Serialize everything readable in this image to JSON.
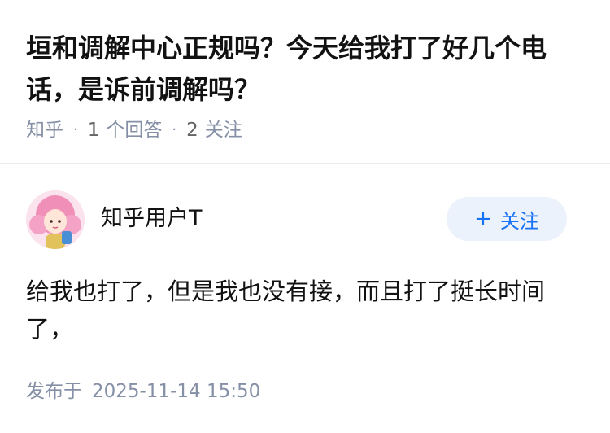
{
  "question": {
    "title": "垣和调解中心正规吗？今天给我打了好几个电话，是诉前调解吗？",
    "source": "知乎",
    "answer_count": "1",
    "answer_label": "个回答",
    "follower_count": "2",
    "follower_label": "关注"
  },
  "answer": {
    "author_name": "知乎用户T",
    "follow_label": "关注",
    "follow_icon": "plus-icon",
    "content": "给我也打了，但是我也没有接，而且打了挺长时间了，",
    "published_label": "发布于",
    "published_time": "2025-11-14 15:50"
  },
  "colors": {
    "accent": "#1772f6",
    "follow_bg": "#ebf2fb",
    "meta_text": "#8590a6",
    "primary_text": "#121212"
  }
}
